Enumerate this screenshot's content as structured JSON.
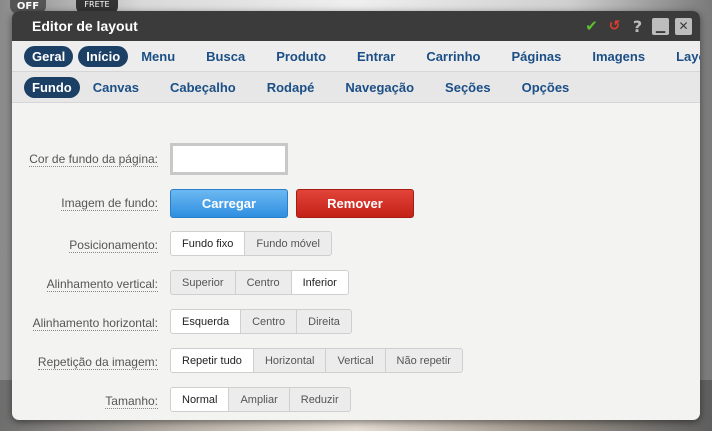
{
  "background": {
    "badge_off": "OFF",
    "badge_frete": "FRETE"
  },
  "window": {
    "title": "Editor de layout"
  },
  "main_nav": [
    {
      "label": "Geral",
      "active": true
    },
    {
      "label": "Início",
      "active": true
    },
    {
      "label": "Menu"
    },
    {
      "label": "Busca"
    },
    {
      "label": "Produto"
    },
    {
      "label": "Entrar"
    },
    {
      "label": "Carrinho"
    },
    {
      "label": "Páginas"
    },
    {
      "label": "Imagens"
    },
    {
      "label": "Layout"
    }
  ],
  "sub_nav": [
    {
      "label": "Fundo",
      "active": true
    },
    {
      "label": "Canvas"
    },
    {
      "label": "Cabeçalho"
    },
    {
      "label": "Rodapé"
    },
    {
      "label": "Navegação"
    },
    {
      "label": "Seções"
    },
    {
      "label": "Opções"
    }
  ],
  "form": {
    "bg_color_label": "Cor de fundo da página:",
    "bg_color_value": "#ffffff",
    "bg_image_label": "Imagem de fundo:",
    "upload_label": "Carregar",
    "remove_label": "Remover",
    "position_label": "Posicionamento:",
    "position_options": [
      "Fundo fixo",
      "Fundo móvel"
    ],
    "position_selected": "Fundo fixo",
    "valign_label": "Alinhamento vertical:",
    "valign_options": [
      "Superior",
      "Centro",
      "Inferior"
    ],
    "valign_selected": "Inferior",
    "halign_label": "Alinhamento horizontal:",
    "halign_options": [
      "Esquerda",
      "Centro",
      "Direita"
    ],
    "halign_selected": "Esquerda",
    "repeat_label": "Repetição da imagem:",
    "repeat_options": [
      "Repetir tudo",
      "Horizontal",
      "Vertical",
      "Não repetir"
    ],
    "repeat_selected": "Repetir tudo",
    "size_label": "Tamanho:",
    "size_options": [
      "Normal",
      "Ampliar",
      "Reduzir"
    ],
    "size_selected": "Normal"
  },
  "colors": {
    "nav_active_bg": "#1c3f66",
    "nav_text": "#1b4f86",
    "upload_blue": "#2f8ee0",
    "remove_red": "#c42116",
    "titlebar": "#3b3b3b"
  }
}
